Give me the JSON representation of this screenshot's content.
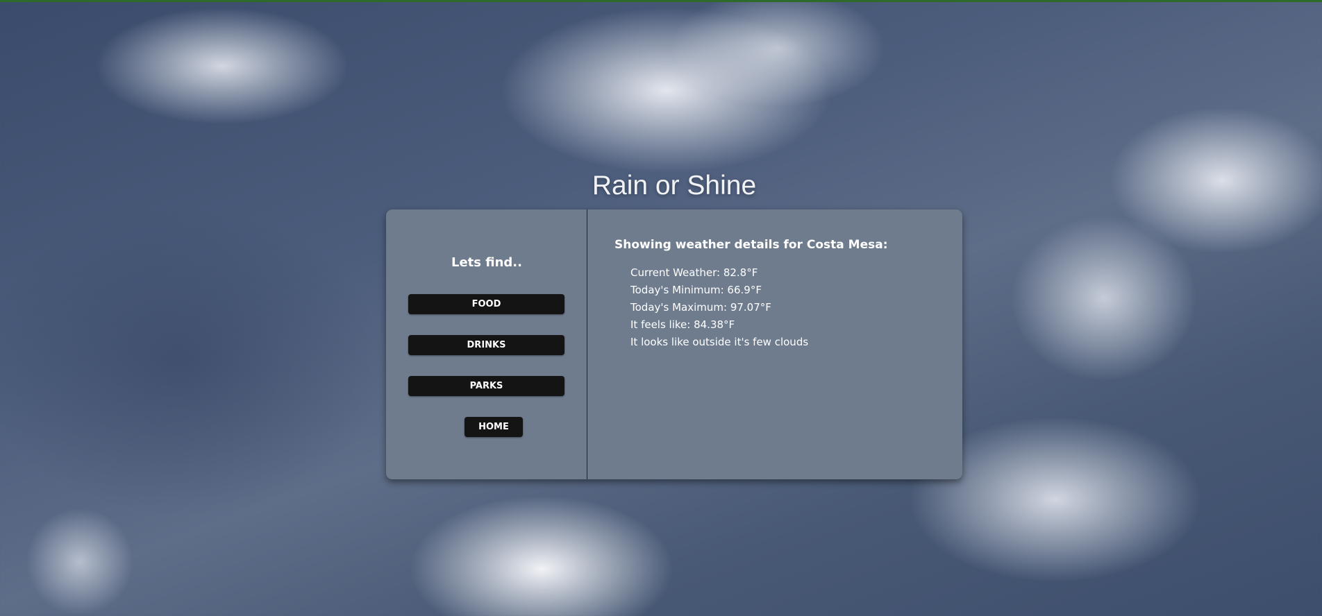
{
  "app": {
    "title": "Rain or Shine"
  },
  "sidebar": {
    "heading": "Lets find..",
    "buttons": {
      "food": "FOOD",
      "drinks": "DRINKS",
      "parks": "PARKS",
      "home": "HOME"
    }
  },
  "weather": {
    "heading": "Showing weather details for Costa Mesa:",
    "lines": [
      "Current Weather: 82.8°F",
      "Today's Minimum: 66.9°F",
      "Today's Maximum: 97.07°F",
      "It feels like: 84.38°F",
      "It looks like outside it's few clouds"
    ]
  },
  "colors": {
    "card_background": "#6e7c8e",
    "button_background": "#141414",
    "top_strip": "#2e6b2b"
  }
}
